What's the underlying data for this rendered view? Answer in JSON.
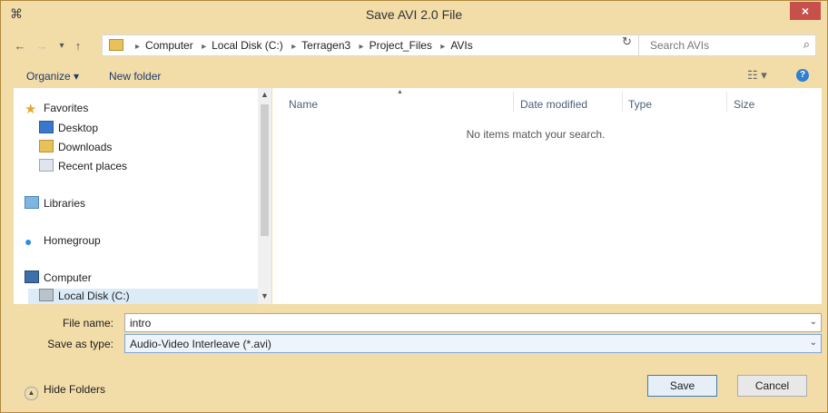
{
  "window": {
    "title": "Save AVI 2.0 File",
    "close_glyph": "×",
    "app_icon": "dialog-app-icon"
  },
  "address": {
    "back_glyph": "←",
    "forward_glyph": "→",
    "recent_glyph": "▾",
    "up_glyph": "↑",
    "breadcrumbs": [
      "Computer",
      "Local Disk (C:)",
      "Terragen3",
      "Project_Files",
      "AVIs"
    ],
    "dropdown_glyph": "⌄",
    "refresh_glyph": "↻"
  },
  "search": {
    "placeholder": "Search AVIs",
    "icon": "search-icon"
  },
  "toolbar": {
    "organize": "Organize ▾",
    "new_folder": "New folder",
    "view_glyph": "☷ ▾",
    "help_glyph": "?"
  },
  "nav": {
    "favorites": "Favorites",
    "desktop": "Desktop",
    "downloads": "Downloads",
    "recent": "Recent places",
    "libraries": "Libraries",
    "homegroup": "Homegroup",
    "computer": "Computer",
    "local_disk": "Local Disk (C:)"
  },
  "columns": {
    "name": "Name",
    "date_modified": "Date modified",
    "type": "Type",
    "size": "Size"
  },
  "empty_message": "No items match your search.",
  "file_name": {
    "label": "File name:",
    "value": "intro"
  },
  "save_type": {
    "label": "Save as type:",
    "value": "Audio-Video Interleave (*.avi)"
  },
  "buttons": {
    "hide_folders": "Hide Folders",
    "save": "Save",
    "cancel": "Cancel"
  },
  "colors": {
    "frame": "#f2dca8",
    "close": "#c7504b",
    "accent": "#2f7fd1"
  }
}
